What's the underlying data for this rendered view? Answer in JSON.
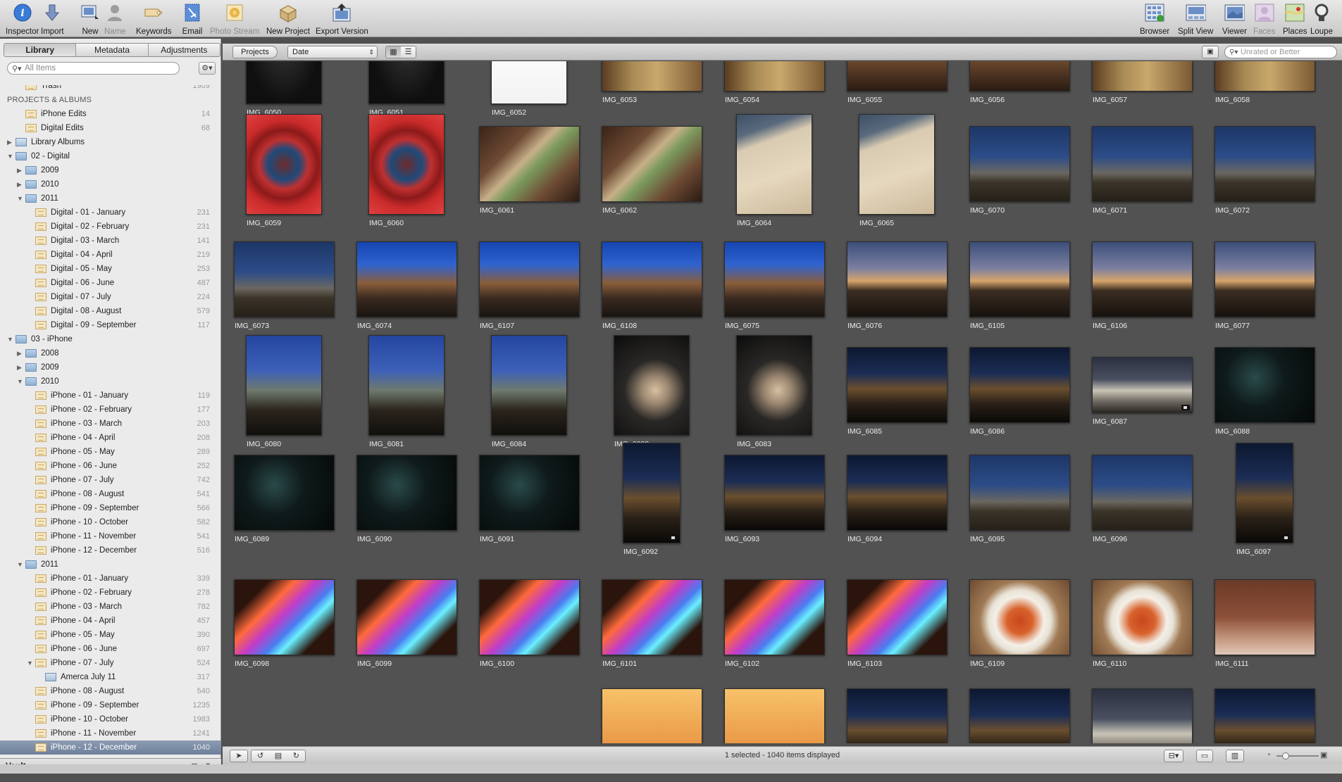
{
  "toolbar": {
    "left": [
      {
        "id": "inspector",
        "label": "Inspector",
        "icon": "info-icon",
        "dim": false
      },
      {
        "id": "import",
        "label": "Import",
        "icon": "import-arrow-icon",
        "dim": false
      },
      {
        "id": "new",
        "label": "New",
        "icon": "new-project-icon",
        "dim": false
      },
      {
        "id": "name",
        "label": "Name",
        "icon": "person-name-icon",
        "dim": true
      },
      {
        "id": "keywords",
        "label": "Keywords",
        "icon": "tag-icon",
        "dim": false
      },
      {
        "id": "email",
        "label": "Email",
        "icon": "email-stamp-icon",
        "dim": false
      },
      {
        "id": "photostream",
        "label": "Photo Stream",
        "icon": "photo-stream-icon",
        "dim": true
      },
      {
        "id": "newproject",
        "label": "New Project",
        "icon": "box-icon",
        "dim": false
      },
      {
        "id": "exportversion",
        "label": "Export Version",
        "icon": "export-icon",
        "dim": false
      }
    ],
    "right": [
      {
        "id": "browser",
        "label": "Browser",
        "icon": "browser-grid-icon",
        "dim": false
      },
      {
        "id": "splitview",
        "label": "Split View",
        "icon": "split-view-icon",
        "dim": false
      },
      {
        "id": "viewer",
        "label": "Viewer",
        "icon": "viewer-icon",
        "dim": false
      },
      {
        "id": "faces",
        "label": "Faces",
        "icon": "faces-icon",
        "dim": true
      },
      {
        "id": "places",
        "label": "Places",
        "icon": "places-map-icon",
        "dim": false
      },
      {
        "id": "loupe",
        "label": "Loupe",
        "icon": "loupe-icon",
        "dim": false
      }
    ]
  },
  "sidebar": {
    "tabs": [
      "Library",
      "Metadata",
      "Adjustments"
    ],
    "active_tab": "Library",
    "search_placeholder": "All Items",
    "rows": [
      {
        "indent": 1,
        "tri": "",
        "icon": "trash",
        "label": "Trash",
        "count": "1909",
        "clip": true
      },
      {
        "indent": 0,
        "tri": "",
        "icon": "",
        "label": "PROJECTS & ALBUMS",
        "count": "",
        "header": true
      },
      {
        "indent": 1,
        "tri": "",
        "icon": "project",
        "label": "iPhone Edits",
        "count": "14"
      },
      {
        "indent": 1,
        "tri": "",
        "icon": "project",
        "label": "Digital Edits",
        "count": "68"
      },
      {
        "indent": 0,
        "tri": "▶",
        "icon": "album",
        "label": "Library Albums",
        "count": ""
      },
      {
        "indent": 0,
        "tri": "▼",
        "icon": "folder",
        "label": "02 - Digital",
        "count": ""
      },
      {
        "indent": 1,
        "tri": "▶",
        "icon": "folder",
        "label": "2009",
        "count": ""
      },
      {
        "indent": 1,
        "tri": "▶",
        "icon": "folder",
        "label": "2010",
        "count": ""
      },
      {
        "indent": 1,
        "tri": "▼",
        "icon": "folder",
        "label": "2011",
        "count": ""
      },
      {
        "indent": 2,
        "tri": "",
        "icon": "project",
        "label": "Digital - 01 - January",
        "count": "231"
      },
      {
        "indent": 2,
        "tri": "",
        "icon": "project",
        "label": "Digital - 02 - February",
        "count": "231"
      },
      {
        "indent": 2,
        "tri": "",
        "icon": "project",
        "label": "Digital - 03 - March",
        "count": "141"
      },
      {
        "indent": 2,
        "tri": "",
        "icon": "project",
        "label": "Digital - 04 - April",
        "count": "219"
      },
      {
        "indent": 2,
        "tri": "",
        "icon": "project",
        "label": "Digital - 05 - May",
        "count": "253"
      },
      {
        "indent": 2,
        "tri": "",
        "icon": "project",
        "label": "Digital - 06 - June",
        "count": "487"
      },
      {
        "indent": 2,
        "tri": "",
        "icon": "project",
        "label": "Digital - 07 - July",
        "count": "224"
      },
      {
        "indent": 2,
        "tri": "",
        "icon": "project",
        "label": "Digital - 08 - August",
        "count": "579"
      },
      {
        "indent": 2,
        "tri": "",
        "icon": "project",
        "label": "Digital - 09 - September",
        "count": "117"
      },
      {
        "indent": 0,
        "tri": "▼",
        "icon": "folder",
        "label": "03 - iPhone",
        "count": ""
      },
      {
        "indent": 1,
        "tri": "▶",
        "icon": "folder",
        "label": "2008",
        "count": ""
      },
      {
        "indent": 1,
        "tri": "▶",
        "icon": "folder",
        "label": "2009",
        "count": ""
      },
      {
        "indent": 1,
        "tri": "▼",
        "icon": "folder",
        "label": "2010",
        "count": ""
      },
      {
        "indent": 2,
        "tri": "",
        "icon": "project",
        "label": "iPhone - 01 - January",
        "count": "119"
      },
      {
        "indent": 2,
        "tri": "",
        "icon": "project",
        "label": "iPhone - 02 - February",
        "count": "177"
      },
      {
        "indent": 2,
        "tri": "",
        "icon": "project",
        "label": "iPhone - 03 - March",
        "count": "203"
      },
      {
        "indent": 2,
        "tri": "",
        "icon": "project",
        "label": "iPhone - 04 - April",
        "count": "208"
      },
      {
        "indent": 2,
        "tri": "",
        "icon": "project",
        "label": "iPhone - 05 - May",
        "count": "289"
      },
      {
        "indent": 2,
        "tri": "",
        "icon": "project",
        "label": "iPhone - 06 - June",
        "count": "252"
      },
      {
        "indent": 2,
        "tri": "",
        "icon": "project",
        "label": "iPhone - 07 - July",
        "count": "742"
      },
      {
        "indent": 2,
        "tri": "",
        "icon": "project",
        "label": "iPhone - 08 - August",
        "count": "541"
      },
      {
        "indent": 2,
        "tri": "",
        "icon": "project",
        "label": "iPhone - 09 - September",
        "count": "566"
      },
      {
        "indent": 2,
        "tri": "",
        "icon": "project",
        "label": "iPhone - 10 - October",
        "count": "582"
      },
      {
        "indent": 2,
        "tri": "",
        "icon": "project",
        "label": "iPhone - 11 - November",
        "count": "541"
      },
      {
        "indent": 2,
        "tri": "",
        "icon": "project",
        "label": "iPhone - 12 - December",
        "count": "516"
      },
      {
        "indent": 1,
        "tri": "▼",
        "icon": "folder",
        "label": "2011",
        "count": ""
      },
      {
        "indent": 2,
        "tri": "",
        "icon": "project",
        "label": "iPhone - 01 - January",
        "count": "339"
      },
      {
        "indent": 2,
        "tri": "",
        "icon": "project",
        "label": "iPhone - 02 - February",
        "count": "278"
      },
      {
        "indent": 2,
        "tri": "",
        "icon": "project",
        "label": "iPhone - 03 - March",
        "count": "782"
      },
      {
        "indent": 2,
        "tri": "",
        "icon": "project",
        "label": "iPhone - 04 - April",
        "count": "457"
      },
      {
        "indent": 2,
        "tri": "",
        "icon": "project",
        "label": "iPhone - 05 - May",
        "count": "390"
      },
      {
        "indent": 2,
        "tri": "",
        "icon": "project",
        "label": "iPhone - 06 - June",
        "count": "697"
      },
      {
        "indent": 2,
        "tri": "▼",
        "icon": "project",
        "label": "iPhone - 07 - July",
        "count": "524"
      },
      {
        "indent": 3,
        "tri": "",
        "icon": "album",
        "label": "Amerca July 11",
        "count": "317"
      },
      {
        "indent": 2,
        "tri": "",
        "icon": "project",
        "label": "iPhone - 08 - August",
        "count": "540"
      },
      {
        "indent": 2,
        "tri": "",
        "icon": "project",
        "label": "iPhone - 09 - September",
        "count": "1235"
      },
      {
        "indent": 2,
        "tri": "",
        "icon": "project",
        "label": "iPhone - 10 - October",
        "count": "1983"
      },
      {
        "indent": 2,
        "tri": "",
        "icon": "project",
        "label": "iPhone - 11 - November",
        "count": "1241"
      },
      {
        "indent": 2,
        "tri": "",
        "icon": "project",
        "label": "iPhone - 12 - December",
        "count": "1040",
        "selected": true
      }
    ],
    "vault_label": "Vault"
  },
  "browser": {
    "projects_label": "Projects",
    "sort_value": "Date",
    "filter_placeholder": "Unrated or Better",
    "status": "1 selected - 1040 items displayed",
    "rows": [
      [
        [
          "IMG_6050",
          "p",
          "dark",
          1
        ],
        [
          "IMG_6051",
          "p",
          "dark",
          1
        ],
        [
          "IMG_6052",
          "p",
          "santa",
          1
        ],
        [
          "IMG_6053",
          "l",
          "xmas",
          1
        ],
        [
          "IMG_6054",
          "l",
          "xmas",
          1
        ],
        [
          "IMG_6055",
          "l",
          "door",
          1
        ],
        [
          "IMG_6056",
          "l",
          "door",
          1
        ],
        [
          "IMG_6057",
          "l",
          "xmas",
          1
        ],
        [
          "IMG_6058",
          "l",
          "xmas",
          1
        ]
      ],
      [
        [
          "IMG_6059",
          "p",
          "red",
          0
        ],
        [
          "IMG_6060",
          "p",
          "red",
          0
        ],
        [
          "IMG_6061",
          "l",
          "toys",
          0
        ],
        [
          "IMG_6062",
          "l",
          "toys",
          0
        ],
        [
          "IMG_6064",
          "p",
          "wall",
          0
        ],
        [
          "IMG_6065",
          "p",
          "wall",
          0
        ],
        [
          "IMG_6070",
          "l",
          "town",
          0
        ],
        [
          "IMG_6071",
          "l",
          "town",
          0
        ],
        [
          "IMG_6072",
          "l",
          "town",
          0
        ]
      ],
      [
        [
          "IMG_6073",
          "l",
          "town",
          0
        ],
        [
          "IMG_6074",
          "l",
          "street",
          0
        ],
        [
          "IMG_6107",
          "l",
          "street",
          0
        ],
        [
          "IMG_6108",
          "l",
          "street",
          0
        ],
        [
          "IMG_6075",
          "l",
          "street",
          0
        ],
        [
          "IMG_6076",
          "l",
          "dusk",
          0
        ],
        [
          "IMG_6105",
          "l",
          "dusk",
          0
        ],
        [
          "IMG_6106",
          "l",
          "dusk",
          0
        ],
        [
          "IMG_6077",
          "l",
          "dusk",
          0
        ]
      ],
      [
        [
          "IMG_6080",
          "p",
          "tree",
          0
        ],
        [
          "IMG_6081",
          "p",
          "tree",
          0
        ],
        [
          "IMG_6084",
          "p",
          "tree",
          0
        ],
        [
          "IMG_6082",
          "p",
          "tax",
          0
        ],
        [
          "IMG_6083",
          "p",
          "tax",
          0
        ],
        [
          "IMG_6085",
          "l",
          "night",
          0
        ],
        [
          "IMG_6086",
          "l",
          "night",
          0
        ],
        [
          "IMG_6087",
          "w",
          "shop",
          0
        ],
        [
          "IMG_6088",
          "l",
          "lights",
          0
        ]
      ],
      [
        [
          "IMG_6089",
          "l",
          "lights",
          0
        ],
        [
          "IMG_6090",
          "l",
          "lights",
          0
        ],
        [
          "IMG_6091",
          "l",
          "lights",
          0
        ],
        [
          "IMG_6092",
          "t",
          "night",
          0
        ],
        [
          "IMG_6093",
          "l",
          "night",
          0
        ],
        [
          "IMG_6094",
          "l",
          "night",
          0
        ],
        [
          "IMG_6095",
          "l",
          "town",
          0
        ],
        [
          "IMG_6096",
          "l",
          "town",
          0
        ],
        [
          "IMG_6097",
          "t",
          "night",
          0
        ]
      ],
      [
        [
          "IMG_6098",
          "l",
          "ipad",
          0
        ],
        [
          "IMG_6099",
          "l",
          "ipad",
          0
        ],
        [
          "IMG_6100",
          "l",
          "ipad",
          0
        ],
        [
          "IMG_6101",
          "l",
          "ipad",
          0
        ],
        [
          "IMG_6102",
          "l",
          "ipad",
          0
        ],
        [
          "IMG_6103",
          "l",
          "ipad",
          0
        ],
        [
          "IMG_6109",
          "l",
          "food",
          0
        ],
        [
          "IMG_6110",
          "l",
          "food",
          0
        ],
        [
          "IMG_6111",
          "l",
          "boot",
          0
        ]
      ],
      [
        [
          "",
          "l",
          "none",
          0
        ],
        [
          "",
          "l",
          "none",
          0
        ],
        [
          "",
          "l",
          "none",
          0
        ],
        [
          "",
          "l",
          "warm",
          0
        ],
        [
          "",
          "l",
          "warm",
          0
        ],
        [
          "",
          "l",
          "night",
          0
        ],
        [
          "",
          "l",
          "night",
          0
        ],
        [
          "",
          "l",
          "shop",
          0
        ],
        [
          "",
          "l",
          "night",
          0
        ]
      ]
    ],
    "videos": [
      "IMG_6087",
      "IMG_6092",
      "IMG_6097"
    ]
  }
}
